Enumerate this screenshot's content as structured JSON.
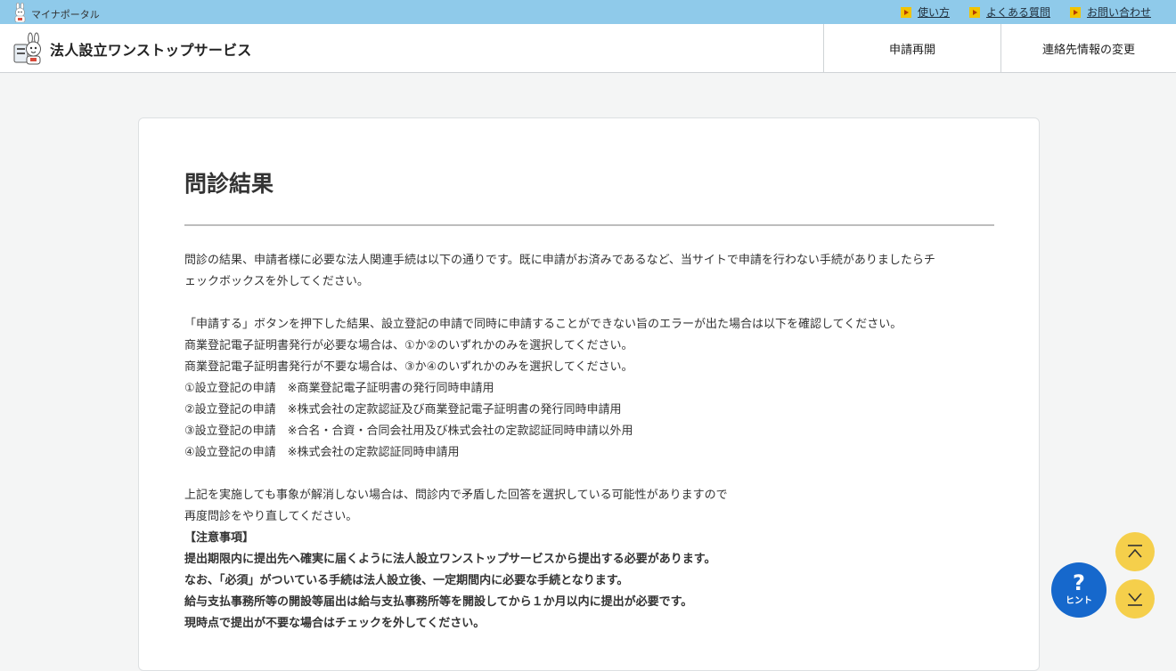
{
  "topbar": {
    "portal_name": "マイナポータル",
    "links": [
      {
        "label": "使い方"
      },
      {
        "label": "よくある質問"
      },
      {
        "label": "お問い合わせ"
      }
    ]
  },
  "header": {
    "service_name": "法人設立ワンストップサービス",
    "nav": [
      {
        "label": "申請再開"
      },
      {
        "label": "連絡先情報の変更"
      }
    ]
  },
  "main": {
    "title": "問診結果",
    "intro_1": "問診の結果、申請者様に必要な法人関連手続は以下の通りです。既に申請がお済みであるなど、当サイトで申請を行わない手続がありましたらチ",
    "intro_2": "ェックボックスを外してください。",
    "lines": [
      "「申請する」ボタンを押下した結果、設立登記の申請で同時に申請することができない旨のエラーが出た場合は以下を確認してください。",
      "商業登記電子証明書発行が必要な場合は、①か②のいずれかのみを選択してください。",
      "商業登記電子証明書発行が不要な場合は、③か④のいずれかのみを選択してください。",
      "①設立登記の申請　※商業登記電子証明書の発行同時申請用",
      "②設立登記の申請　※株式会社の定款認証及び商業登記電子証明書の発行同時申請用",
      "③設立登記の申請　※合名・合資・合同会社用及び株式会社の定款認証同時申請以外用",
      "④設立登記の申請　※株式会社の定款認証同時申請用"
    ],
    "after_1": "上記を実施しても事象が解消しない場合は、問診内で矛盾した回答を選択している可能性がありますので",
    "after_2": "再度問診をやり直してください。",
    "notice_heading": "【注意事項】",
    "notice_1": "提出期限内に提出先へ確実に届くように法人設立ワンストップサービスから提出する必要があります。",
    "notice_2": "なお、「必須」がついている手続は法人設立後、一定期間内に必要な手続となります。",
    "notice_3": "給与支払事務所等の開設等届出は給与支払事務所等を開設してから１か月以内に提出が必要です。",
    "notice_4": "現時点で提出が不要な場合はチェックを外してください。"
  },
  "floating": {
    "hint_label": "ヒント",
    "hint_symbol": "?"
  },
  "colors": {
    "topbar": "#8fcaea",
    "accent_yellow": "#f5cf4b",
    "hint_blue": "#1668cc"
  }
}
